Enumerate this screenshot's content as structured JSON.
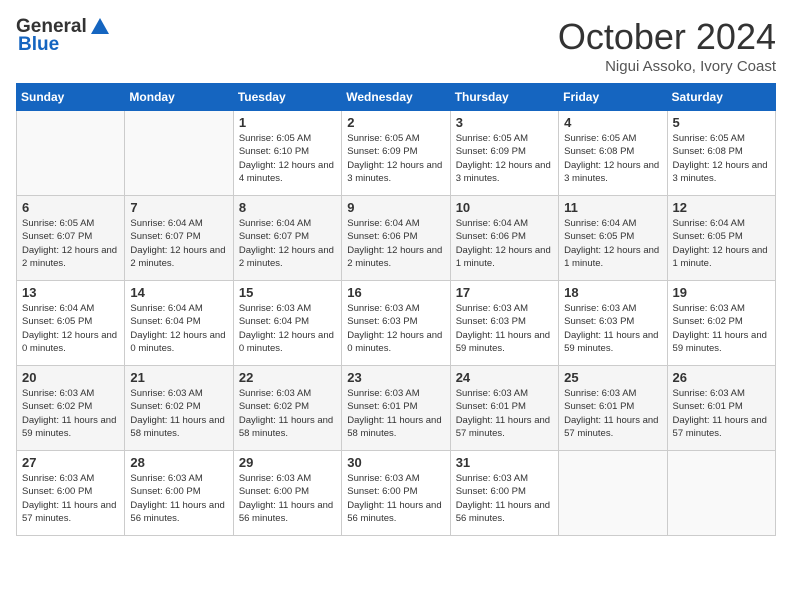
{
  "logo": {
    "general": "General",
    "blue": "Blue"
  },
  "title": "October 2024",
  "location": "Nigui Assoko, Ivory Coast",
  "weekdays": [
    "Sunday",
    "Monday",
    "Tuesday",
    "Wednesday",
    "Thursday",
    "Friday",
    "Saturday"
  ],
  "weeks": [
    [
      {
        "day": "",
        "info": ""
      },
      {
        "day": "",
        "info": ""
      },
      {
        "day": "1",
        "info": "Sunrise: 6:05 AM\nSunset: 6:10 PM\nDaylight: 12 hours and 4 minutes."
      },
      {
        "day": "2",
        "info": "Sunrise: 6:05 AM\nSunset: 6:09 PM\nDaylight: 12 hours and 3 minutes."
      },
      {
        "day": "3",
        "info": "Sunrise: 6:05 AM\nSunset: 6:09 PM\nDaylight: 12 hours and 3 minutes."
      },
      {
        "day": "4",
        "info": "Sunrise: 6:05 AM\nSunset: 6:08 PM\nDaylight: 12 hours and 3 minutes."
      },
      {
        "day": "5",
        "info": "Sunrise: 6:05 AM\nSunset: 6:08 PM\nDaylight: 12 hours and 3 minutes."
      }
    ],
    [
      {
        "day": "6",
        "info": "Sunrise: 6:05 AM\nSunset: 6:07 PM\nDaylight: 12 hours and 2 minutes."
      },
      {
        "day": "7",
        "info": "Sunrise: 6:04 AM\nSunset: 6:07 PM\nDaylight: 12 hours and 2 minutes."
      },
      {
        "day": "8",
        "info": "Sunrise: 6:04 AM\nSunset: 6:07 PM\nDaylight: 12 hours and 2 minutes."
      },
      {
        "day": "9",
        "info": "Sunrise: 6:04 AM\nSunset: 6:06 PM\nDaylight: 12 hours and 2 minutes."
      },
      {
        "day": "10",
        "info": "Sunrise: 6:04 AM\nSunset: 6:06 PM\nDaylight: 12 hours and 1 minute."
      },
      {
        "day": "11",
        "info": "Sunrise: 6:04 AM\nSunset: 6:05 PM\nDaylight: 12 hours and 1 minute."
      },
      {
        "day": "12",
        "info": "Sunrise: 6:04 AM\nSunset: 6:05 PM\nDaylight: 12 hours and 1 minute."
      }
    ],
    [
      {
        "day": "13",
        "info": "Sunrise: 6:04 AM\nSunset: 6:05 PM\nDaylight: 12 hours and 0 minutes."
      },
      {
        "day": "14",
        "info": "Sunrise: 6:04 AM\nSunset: 6:04 PM\nDaylight: 12 hours and 0 minutes."
      },
      {
        "day": "15",
        "info": "Sunrise: 6:03 AM\nSunset: 6:04 PM\nDaylight: 12 hours and 0 minutes."
      },
      {
        "day": "16",
        "info": "Sunrise: 6:03 AM\nSunset: 6:03 PM\nDaylight: 12 hours and 0 minutes."
      },
      {
        "day": "17",
        "info": "Sunrise: 6:03 AM\nSunset: 6:03 PM\nDaylight: 11 hours and 59 minutes."
      },
      {
        "day": "18",
        "info": "Sunrise: 6:03 AM\nSunset: 6:03 PM\nDaylight: 11 hours and 59 minutes."
      },
      {
        "day": "19",
        "info": "Sunrise: 6:03 AM\nSunset: 6:02 PM\nDaylight: 11 hours and 59 minutes."
      }
    ],
    [
      {
        "day": "20",
        "info": "Sunrise: 6:03 AM\nSunset: 6:02 PM\nDaylight: 11 hours and 59 minutes."
      },
      {
        "day": "21",
        "info": "Sunrise: 6:03 AM\nSunset: 6:02 PM\nDaylight: 11 hours and 58 minutes."
      },
      {
        "day": "22",
        "info": "Sunrise: 6:03 AM\nSunset: 6:02 PM\nDaylight: 11 hours and 58 minutes."
      },
      {
        "day": "23",
        "info": "Sunrise: 6:03 AM\nSunset: 6:01 PM\nDaylight: 11 hours and 58 minutes."
      },
      {
        "day": "24",
        "info": "Sunrise: 6:03 AM\nSunset: 6:01 PM\nDaylight: 11 hours and 57 minutes."
      },
      {
        "day": "25",
        "info": "Sunrise: 6:03 AM\nSunset: 6:01 PM\nDaylight: 11 hours and 57 minutes."
      },
      {
        "day": "26",
        "info": "Sunrise: 6:03 AM\nSunset: 6:01 PM\nDaylight: 11 hours and 57 minutes."
      }
    ],
    [
      {
        "day": "27",
        "info": "Sunrise: 6:03 AM\nSunset: 6:00 PM\nDaylight: 11 hours and 57 minutes."
      },
      {
        "day": "28",
        "info": "Sunrise: 6:03 AM\nSunset: 6:00 PM\nDaylight: 11 hours and 56 minutes."
      },
      {
        "day": "29",
        "info": "Sunrise: 6:03 AM\nSunset: 6:00 PM\nDaylight: 11 hours and 56 minutes."
      },
      {
        "day": "30",
        "info": "Sunrise: 6:03 AM\nSunset: 6:00 PM\nDaylight: 11 hours and 56 minutes."
      },
      {
        "day": "31",
        "info": "Sunrise: 6:03 AM\nSunset: 6:00 PM\nDaylight: 11 hours and 56 minutes."
      },
      {
        "day": "",
        "info": ""
      },
      {
        "day": "",
        "info": ""
      }
    ]
  ]
}
